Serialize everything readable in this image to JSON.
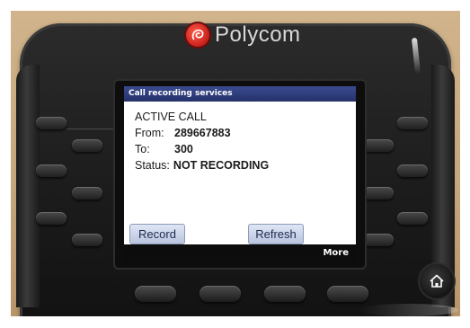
{
  "device": {
    "brand": "Polycom",
    "brand_icon": "polycom-logo-icon",
    "accent_color": "#c8201a"
  },
  "screen": {
    "title": "Call recording services",
    "title_bar_color": "#2e3c7c",
    "call_state": "ACTIVE CALL",
    "from_label": "From:",
    "from_value": "289667883",
    "to_label": "To:",
    "to_value": "300",
    "status_label": "Status:",
    "status_value": "NOT RECORDING",
    "softkeys": [
      {
        "label": "Record"
      },
      {
        "label": "Refresh"
      }
    ],
    "more_label": "More"
  },
  "hardware": {
    "home_icon": "home-icon"
  }
}
